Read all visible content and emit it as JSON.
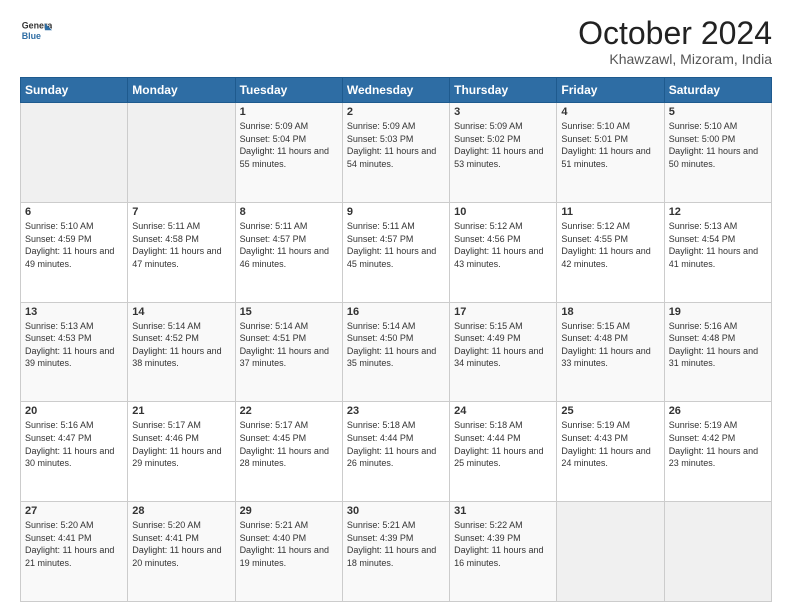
{
  "header": {
    "logo_line1": "General",
    "logo_line2": "Blue",
    "main_title": "October 2024",
    "subtitle": "Khawzawl, Mizoram, India"
  },
  "calendar": {
    "days_of_week": [
      "Sunday",
      "Monday",
      "Tuesday",
      "Wednesday",
      "Thursday",
      "Friday",
      "Saturday"
    ],
    "weeks": [
      [
        {
          "day": "",
          "content": ""
        },
        {
          "day": "",
          "content": ""
        },
        {
          "day": "1",
          "content": "Sunrise: 5:09 AM\nSunset: 5:04 PM\nDaylight: 11 hours and 55 minutes."
        },
        {
          "day": "2",
          "content": "Sunrise: 5:09 AM\nSunset: 5:03 PM\nDaylight: 11 hours and 54 minutes."
        },
        {
          "day": "3",
          "content": "Sunrise: 5:09 AM\nSunset: 5:02 PM\nDaylight: 11 hours and 53 minutes."
        },
        {
          "day": "4",
          "content": "Sunrise: 5:10 AM\nSunset: 5:01 PM\nDaylight: 11 hours and 51 minutes."
        },
        {
          "day": "5",
          "content": "Sunrise: 5:10 AM\nSunset: 5:00 PM\nDaylight: 11 hours and 50 minutes."
        }
      ],
      [
        {
          "day": "6",
          "content": "Sunrise: 5:10 AM\nSunset: 4:59 PM\nDaylight: 11 hours and 49 minutes."
        },
        {
          "day": "7",
          "content": "Sunrise: 5:11 AM\nSunset: 4:58 PM\nDaylight: 11 hours and 47 minutes."
        },
        {
          "day": "8",
          "content": "Sunrise: 5:11 AM\nSunset: 4:57 PM\nDaylight: 11 hours and 46 minutes."
        },
        {
          "day": "9",
          "content": "Sunrise: 5:11 AM\nSunset: 4:57 PM\nDaylight: 11 hours and 45 minutes."
        },
        {
          "day": "10",
          "content": "Sunrise: 5:12 AM\nSunset: 4:56 PM\nDaylight: 11 hours and 43 minutes."
        },
        {
          "day": "11",
          "content": "Sunrise: 5:12 AM\nSunset: 4:55 PM\nDaylight: 11 hours and 42 minutes."
        },
        {
          "day": "12",
          "content": "Sunrise: 5:13 AM\nSunset: 4:54 PM\nDaylight: 11 hours and 41 minutes."
        }
      ],
      [
        {
          "day": "13",
          "content": "Sunrise: 5:13 AM\nSunset: 4:53 PM\nDaylight: 11 hours and 39 minutes."
        },
        {
          "day": "14",
          "content": "Sunrise: 5:14 AM\nSunset: 4:52 PM\nDaylight: 11 hours and 38 minutes."
        },
        {
          "day": "15",
          "content": "Sunrise: 5:14 AM\nSunset: 4:51 PM\nDaylight: 11 hours and 37 minutes."
        },
        {
          "day": "16",
          "content": "Sunrise: 5:14 AM\nSunset: 4:50 PM\nDaylight: 11 hours and 35 minutes."
        },
        {
          "day": "17",
          "content": "Sunrise: 5:15 AM\nSunset: 4:49 PM\nDaylight: 11 hours and 34 minutes."
        },
        {
          "day": "18",
          "content": "Sunrise: 5:15 AM\nSunset: 4:48 PM\nDaylight: 11 hours and 33 minutes."
        },
        {
          "day": "19",
          "content": "Sunrise: 5:16 AM\nSunset: 4:48 PM\nDaylight: 11 hours and 31 minutes."
        }
      ],
      [
        {
          "day": "20",
          "content": "Sunrise: 5:16 AM\nSunset: 4:47 PM\nDaylight: 11 hours and 30 minutes."
        },
        {
          "day": "21",
          "content": "Sunrise: 5:17 AM\nSunset: 4:46 PM\nDaylight: 11 hours and 29 minutes."
        },
        {
          "day": "22",
          "content": "Sunrise: 5:17 AM\nSunset: 4:45 PM\nDaylight: 11 hours and 28 minutes."
        },
        {
          "day": "23",
          "content": "Sunrise: 5:18 AM\nSunset: 4:44 PM\nDaylight: 11 hours and 26 minutes."
        },
        {
          "day": "24",
          "content": "Sunrise: 5:18 AM\nSunset: 4:44 PM\nDaylight: 11 hours and 25 minutes."
        },
        {
          "day": "25",
          "content": "Sunrise: 5:19 AM\nSunset: 4:43 PM\nDaylight: 11 hours and 24 minutes."
        },
        {
          "day": "26",
          "content": "Sunrise: 5:19 AM\nSunset: 4:42 PM\nDaylight: 11 hours and 23 minutes."
        }
      ],
      [
        {
          "day": "27",
          "content": "Sunrise: 5:20 AM\nSunset: 4:41 PM\nDaylight: 11 hours and 21 minutes."
        },
        {
          "day": "28",
          "content": "Sunrise: 5:20 AM\nSunset: 4:41 PM\nDaylight: 11 hours and 20 minutes."
        },
        {
          "day": "29",
          "content": "Sunrise: 5:21 AM\nSunset: 4:40 PM\nDaylight: 11 hours and 19 minutes."
        },
        {
          "day": "30",
          "content": "Sunrise: 5:21 AM\nSunset: 4:39 PM\nDaylight: 11 hours and 18 minutes."
        },
        {
          "day": "31",
          "content": "Sunrise: 5:22 AM\nSunset: 4:39 PM\nDaylight: 11 hours and 16 minutes."
        },
        {
          "day": "",
          "content": ""
        },
        {
          "day": "",
          "content": ""
        }
      ]
    ]
  }
}
